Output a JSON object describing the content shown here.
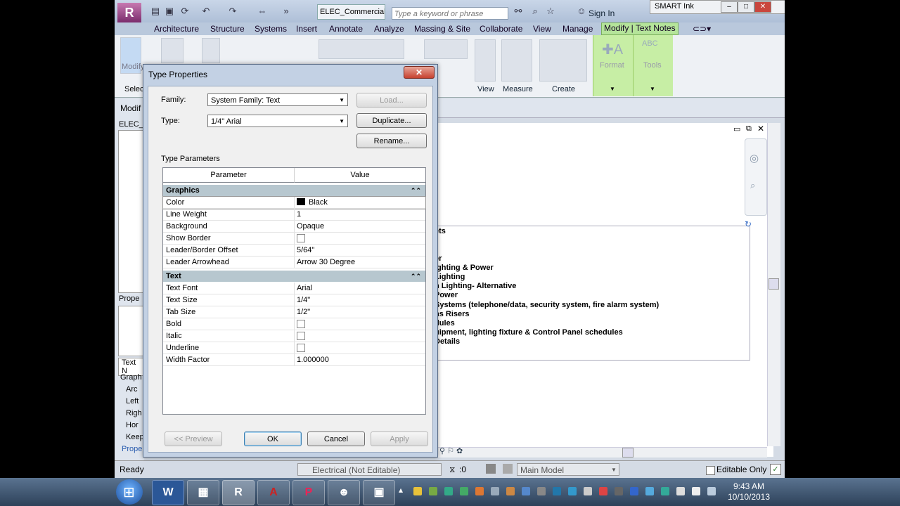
{
  "titlebar": {
    "filename": "ELEC_Commercial",
    "search_placeholder": "Type a keyword or phrase",
    "signin": "Sign In",
    "smart_ink": "SMART Ink"
  },
  "ribbon": {
    "tabs": [
      "Architecture",
      "Structure",
      "Systems",
      "Insert",
      "Annotate",
      "Analyze",
      "Massing & Site",
      "Collaborate",
      "View",
      "Manage"
    ],
    "active_tab": "Modify | Text Notes",
    "panels": {
      "view": "View",
      "measure": "Measure",
      "create": "Create",
      "format": "Format",
      "tools": "Tools",
      "select": "Select",
      "modify": "Modify"
    }
  },
  "left_fragments": {
    "modify": "Modif",
    "elec": "ELEC_C",
    "properties": "Prope",
    "text": "Text N",
    "graph": "Graph",
    "arc": "Arc",
    "left": "Left",
    "right": "Righ",
    "hor": "Hor",
    "keep": "Keep",
    "props_link": "Prope"
  },
  "canvas_notes": [
    "ets",
    "t",
    "er",
    "ighting & Power",
    "Lighting",
    "n Lighting- Alternative",
    "Power",
    "Systems (telephone/data, security system, fire alarm system)",
    "ns Risers",
    "dules",
    "uipment, lighting fixture & Control Panel schedules",
    "Details"
  ],
  "status": {
    "ready": "Ready",
    "workset": "Electrical (Not Editable)",
    "count": ":0",
    "model": "Main Model",
    "editable_only": "Editable Only"
  },
  "dialog": {
    "title": "Type Properties",
    "family_label": "Family:",
    "family_value": "System Family: Text",
    "type_label": "Type:",
    "type_value": "1/4\" Arial",
    "load": "Load...",
    "duplicate": "Duplicate...",
    "rename": "Rename...",
    "type_parameters": "Type Parameters",
    "col_parameter": "Parameter",
    "col_value": "Value",
    "groups": [
      {
        "name": "Graphics",
        "rows": [
          {
            "p": "Color",
            "v": "Black"
          },
          {
            "p": "Line Weight",
            "v": "1"
          },
          {
            "p": "Background",
            "v": "Opaque"
          },
          {
            "p": "Show Border",
            "v": ""
          },
          {
            "p": "Leader/Border Offset",
            "v": "5/64\""
          },
          {
            "p": "Leader Arrowhead",
            "v": "Arrow 30 Degree"
          }
        ]
      },
      {
        "name": "Text",
        "rows": [
          {
            "p": "Text Font",
            "v": "Arial"
          },
          {
            "p": "Text Size",
            "v": "1/4\""
          },
          {
            "p": "Tab Size",
            "v": "1/2\""
          },
          {
            "p": "Bold",
            "v": ""
          },
          {
            "p": "Italic",
            "v": ""
          },
          {
            "p": "Underline",
            "v": ""
          },
          {
            "p": "Width Factor",
            "v": "1.000000"
          }
        ]
      }
    ],
    "preview": "<< Preview",
    "ok": "OK",
    "cancel": "Cancel",
    "apply": "Apply"
  },
  "taskbar": {
    "time": "9:43 AM",
    "date": "10/10/2013"
  }
}
